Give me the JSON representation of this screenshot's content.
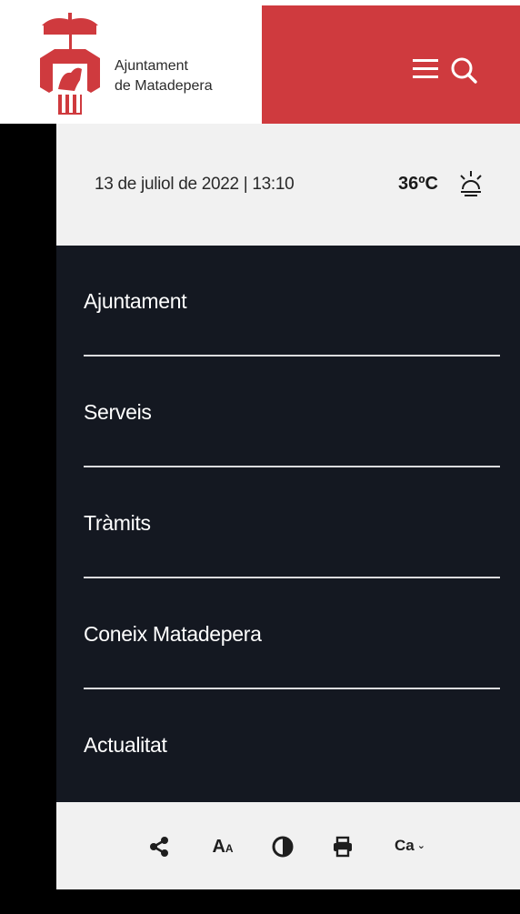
{
  "header": {
    "logo_line1": "Ajuntament",
    "logo_line2": "de Matadepera",
    "accent_color": "#cf3a3e",
    "menu_icon": "hamburger-icon",
    "search_icon": "search-icon"
  },
  "info": {
    "date": "13 de juliol de 2022 | 13:10",
    "temperature": "36ºC",
    "weather_icon": "sun-icon"
  },
  "nav": {
    "background": "#141821",
    "items": [
      {
        "label": "Ajuntament"
      },
      {
        "label": "Serveis"
      },
      {
        "label": "Tràmits"
      },
      {
        "label": "Coneix Matadepera"
      },
      {
        "label": "Actualitat"
      }
    ]
  },
  "tools": {
    "share_icon": "share-icon",
    "font_big": "A",
    "font_small": "A",
    "contrast_icon": "contrast-icon",
    "print_icon": "print-icon",
    "language": "Ca",
    "language_chevron": "⌄"
  }
}
